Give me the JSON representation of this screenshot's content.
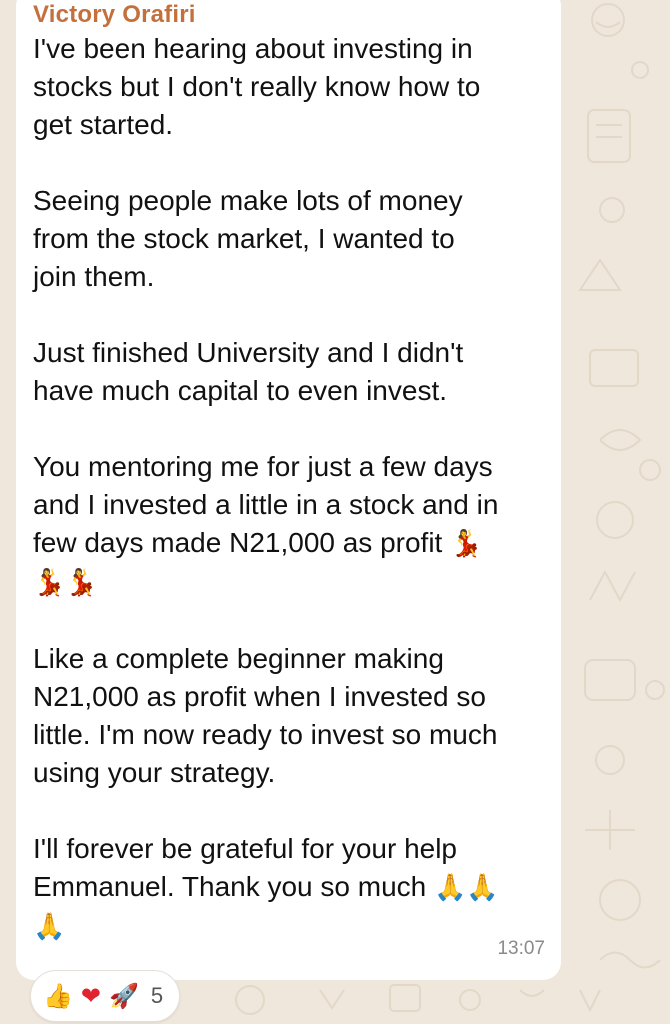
{
  "message": {
    "sender": "Victory Orafiri",
    "paragraphs": [
      "I've been hearing about investing in\nstocks but I don't really know how to\nget started.",
      "Seeing people make lots of money\nfrom the stock market, I wanted to\njoin them.",
      "Just finished University and I didn't\nhave much capital to even invest.",
      "You mentoring me for just a few days\nand I invested a little in a stock and in\nfew days made N21,000 as profit",
      "Like a complete beginner making\nN21,000 as profit when I invested so\nlittle. I'm now ready to invest so much\nusing your strategy.",
      "I'll forever be grateful for your help\nEmmanuel. Thank you so much"
    ],
    "emojis": {
      "dancer": "💃",
      "praying": "🙏"
    },
    "timestamp": "13:07"
  },
  "reactions": {
    "thumbs": "👍",
    "heart": "❤",
    "rocket": "🚀",
    "count": "5"
  },
  "colors": {
    "wallpaper": "#efe7dc",
    "bubble": "#ffffff",
    "sender": "#c3703d",
    "timestamp": "#8a8a8a"
  },
  "icons": [
    "doodle-wallpaper",
    "dancer-emoji",
    "praying-hands-emoji",
    "thumbs-up-emoji",
    "heart-emoji",
    "rocket-emoji"
  ]
}
